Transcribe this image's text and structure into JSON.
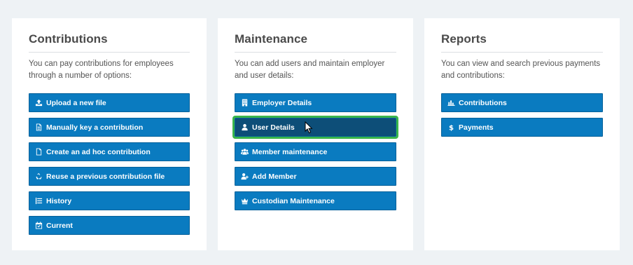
{
  "panels": [
    {
      "title": "Contributions",
      "description": "You can pay contributions for employees through a number of options:",
      "buttons": [
        {
          "label": "Upload a new file",
          "icon": "upload-icon"
        },
        {
          "label": "Manually key a contribution",
          "icon": "document-text-icon"
        },
        {
          "label": "Create an ad hoc contribution",
          "icon": "document-icon"
        },
        {
          "label": "Reuse a previous contribution file",
          "icon": "recycle-icon"
        },
        {
          "label": "History",
          "icon": "list-icon"
        },
        {
          "label": "Current",
          "icon": "calendar-check-icon"
        }
      ]
    },
    {
      "title": "Maintenance",
      "description": "You can add users and maintain employer and user details:",
      "buttons": [
        {
          "label": "Employer Details",
          "icon": "building-icon"
        },
        {
          "label": "User Details",
          "icon": "user-icon",
          "active": true
        },
        {
          "label": "Member maintenance",
          "icon": "users-icon"
        },
        {
          "label": "Add Member",
          "icon": "user-plus-icon"
        },
        {
          "label": "Custodian Maintenance",
          "icon": "crown-icon"
        }
      ]
    },
    {
      "title": "Reports",
      "description": "You can view and search previous payments and contributions:",
      "buttons": [
        {
          "label": "Contributions",
          "icon": "bar-chart-icon"
        },
        {
          "label": "Payments",
          "icon": "dollar-icon"
        }
      ]
    }
  ],
  "colors": {
    "button": "#0a7bc0",
    "button_active": "#0d4e78",
    "focus_outline": "#39b54a",
    "background": "#eef2f5"
  }
}
